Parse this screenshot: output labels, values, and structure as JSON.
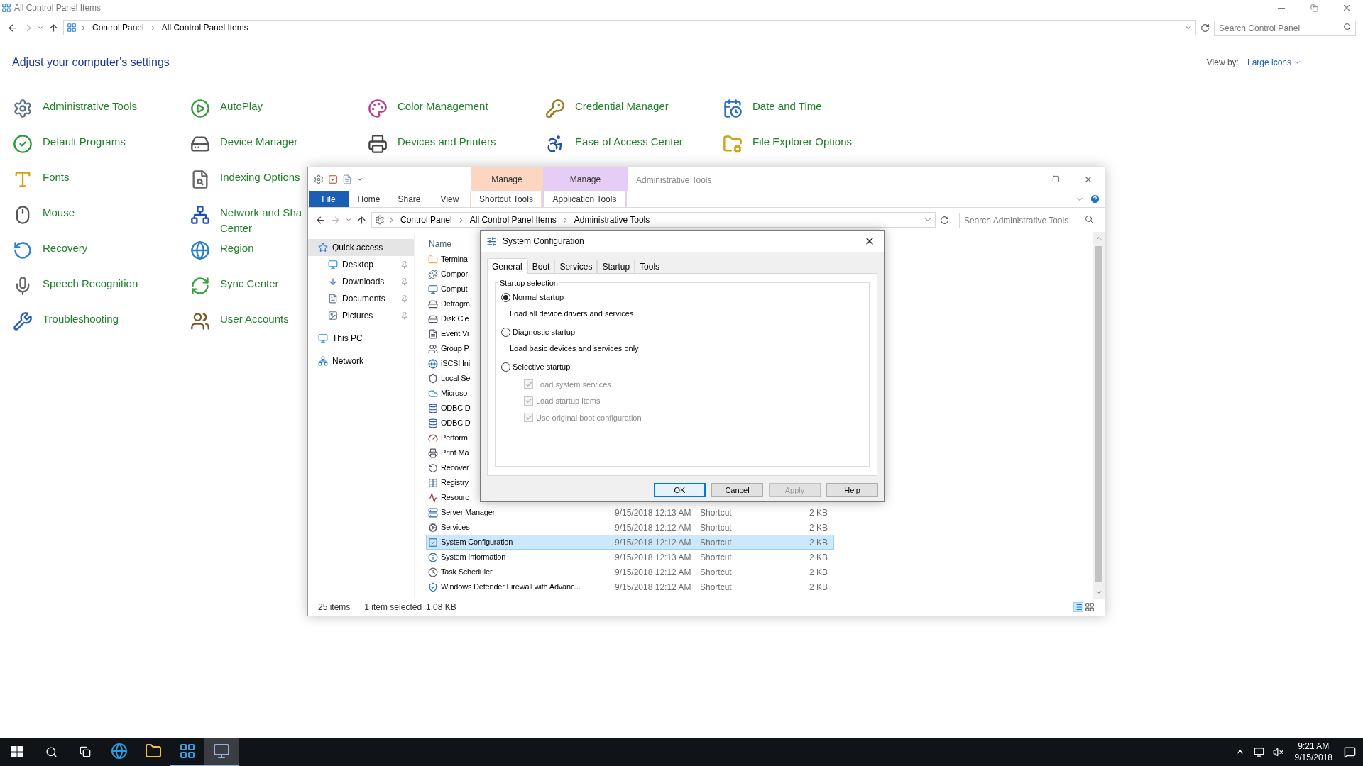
{
  "control_panel": {
    "title": "All Control Panel Items",
    "breadcrumb": [
      "Control Panel",
      "All Control Panel Items"
    ],
    "search": {
      "placeholder": "Search Control Panel"
    },
    "heading": "Adjust your computer's settings",
    "view_by_label": "View by:",
    "view_by_value": "Large icons",
    "columns": [
      {
        "items": [
          {
            "lines": [
              "Administrative Tools"
            ]
          },
          {
            "lines": [
              "Default Programs"
            ]
          },
          {
            "lines": [
              "Fonts"
            ]
          },
          {
            "lines": [
              "Mouse"
            ]
          },
          {
            "lines": [
              "Recovery"
            ]
          },
          {
            "lines": [
              "Speech Recognition"
            ]
          },
          {
            "lines": [
              "Troubleshooting"
            ]
          }
        ]
      },
      {
        "items": [
          {
            "lines": [
              "AutoPlay"
            ]
          },
          {
            "lines": [
              "Device Manager"
            ]
          },
          {
            "lines": [
              "Indexing Options"
            ]
          },
          {
            "lines": [
              "Network and Sha",
              "Center"
            ]
          },
          {
            "lines": [
              "Region"
            ]
          },
          {
            "lines": [
              "Sync Center"
            ]
          },
          {
            "lines": [
              "User Accounts"
            ]
          }
        ]
      },
      {
        "items": [
          {
            "lines": [
              "Color Management"
            ]
          },
          {
            "lines": [
              "Devices and Printers"
            ]
          }
        ]
      },
      {
        "items": [
          {
            "lines": [
              "Credential Manager"
            ]
          },
          {
            "lines": [
              "Ease of Access Center"
            ]
          }
        ]
      },
      {
        "items": [
          {
            "lines": [
              "Date and Time"
            ]
          },
          {
            "lines": [
              "File Explorer Options"
            ]
          }
        ]
      }
    ]
  },
  "explorer": {
    "title": "Administrative Tools",
    "context_tabs": [
      {
        "group": "Manage",
        "label": "Shortcut Tools",
        "color": "#fcd6c0"
      },
      {
        "group": "Manage",
        "label": "Application Tools",
        "color": "#e6cdf5"
      }
    ],
    "file_tab": "File",
    "ribbon_tabs": [
      "Home",
      "Share",
      "View"
    ],
    "breadcrumb": [
      "Control Panel",
      "All Control Panel Items",
      "Administrative Tools"
    ],
    "search": {
      "placeholder": "Search Administrative Tools"
    },
    "nav": [
      {
        "label": "Quick access",
        "selected": true,
        "children": [
          {
            "label": "Desktop",
            "selected": false,
            "pinned": true
          },
          {
            "label": "Downloads",
            "selected": false,
            "pinned": true
          },
          {
            "label": "Documents",
            "selected": false,
            "pinned": true
          },
          {
            "label": "Pictures",
            "selected": false,
            "pinned": true
          }
        ]
      },
      {
        "label": "This PC",
        "selected": false
      },
      {
        "label": "Network",
        "selected": false
      }
    ],
    "column_header": "Name",
    "files": [
      {
        "name": "Termina",
        "selected": false
      },
      {
        "name": "Compor",
        "selected": false
      },
      {
        "name": "Comput",
        "selected": false
      },
      {
        "name": "Defragm",
        "selected": false
      },
      {
        "name": "Disk Cle",
        "selected": false
      },
      {
        "name": "Event Vi",
        "selected": false
      },
      {
        "name": "Group P",
        "selected": false
      },
      {
        "name": "iSCSI Ini",
        "selected": false
      },
      {
        "name": "Local Se",
        "selected": false
      },
      {
        "name": "Microso",
        "selected": false
      },
      {
        "name": "ODBC D",
        "selected": false
      },
      {
        "name": "ODBC D",
        "selected": false
      },
      {
        "name": "Perform",
        "selected": false
      },
      {
        "name": "Print Ma",
        "selected": false
      },
      {
        "name": "Recover",
        "selected": false
      },
      {
        "name": "Registry",
        "selected": false
      },
      {
        "name": "Resourc",
        "selected": false
      },
      {
        "name": "Server Manager",
        "date": "9/15/2018 12:13 AM",
        "type": "Shortcut",
        "size": "2 KB",
        "selected": false
      },
      {
        "name": "Services",
        "date": "9/15/2018 12:12 AM",
        "type": "Shortcut",
        "size": "2 KB",
        "selected": false
      },
      {
        "name": "System Configuration",
        "date": "9/15/2018 12:12 AM",
        "type": "Shortcut",
        "size": "2 KB",
        "selected": true
      },
      {
        "name": "System Information",
        "date": "9/15/2018 12:13 AM",
        "type": "Shortcut",
        "size": "2 KB",
        "selected": false
      },
      {
        "name": "Task Scheduler",
        "date": "9/15/2018 12:12 AM",
        "type": "Shortcut",
        "size": "2 KB",
        "selected": false
      },
      {
        "name": "Windows Defender Firewall with Advanc...",
        "date": "9/15/2018 12:12 AM",
        "type": "Shortcut",
        "size": "2 KB",
        "selected": false
      }
    ],
    "status": [
      "25 items",
      "1 item selected",
      "1.08 KB"
    ]
  },
  "dialog": {
    "title": "System Configuration",
    "tabs": [
      {
        "label": "General",
        "selected": true
      },
      {
        "label": "Boot",
        "selected": false
      },
      {
        "label": "Services",
        "selected": false
      },
      {
        "label": "Startup",
        "selected": false
      },
      {
        "label": "Tools",
        "selected": false
      }
    ],
    "group_label": "Startup selection",
    "options": [
      {
        "label": "Normal startup",
        "description": "Load all device drivers and services",
        "selected": true
      },
      {
        "label": "Diagnostic startup",
        "description": "Load basic devices and services only",
        "selected": false
      },
      {
        "label": "Selective startup",
        "selected": false
      }
    ],
    "selective_items": [
      {
        "label": "Load system services",
        "checked": true,
        "disabled": true
      },
      {
        "label": "Load startup items",
        "checked": true,
        "disabled": true
      },
      {
        "label": "Use original boot configuration",
        "checked": true,
        "disabled": true
      }
    ],
    "buttons": [
      {
        "label": "OK",
        "default": true,
        "disabled": false
      },
      {
        "label": "Cancel",
        "default": false,
        "disabled": false
      },
      {
        "label": "Apply",
        "default": false,
        "disabled": true
      },
      {
        "label": "Help",
        "default": false,
        "disabled": false
      }
    ]
  },
  "taskbar": {
    "apps": [
      {
        "kind": "browser",
        "running": false,
        "active": false
      },
      {
        "kind": "files",
        "running": false,
        "active": false
      },
      {
        "kind": "control",
        "running": true,
        "active": false
      },
      {
        "kind": "config",
        "running": true,
        "active": true
      }
    ],
    "time": "9:21 AM",
    "date": "9/15/2018"
  }
}
